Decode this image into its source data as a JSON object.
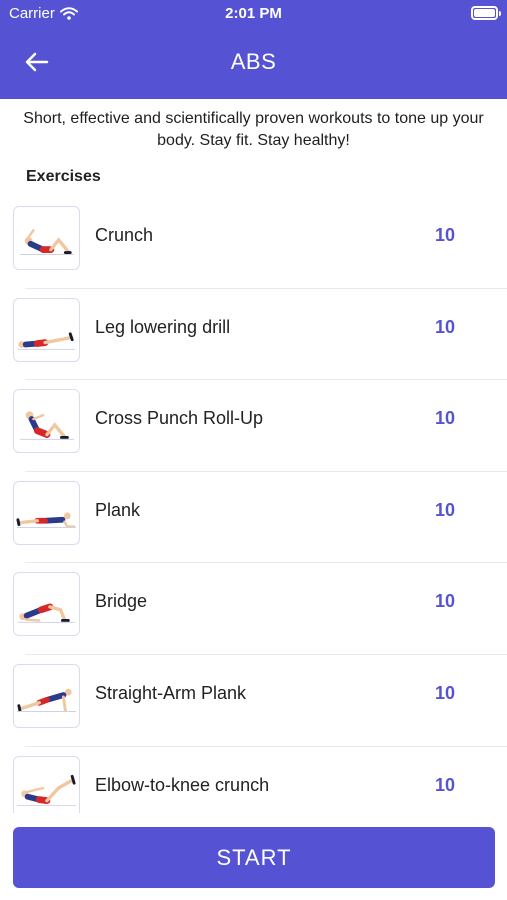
{
  "status_bar": {
    "carrier": "Carrier",
    "time": "2:01 PM"
  },
  "header": {
    "title": "ABS",
    "background": "#5553d3"
  },
  "description": "Short, effective and scientifically proven workouts to tone up your body. Stay fit. Stay healthy!",
  "section_title": "Exercises",
  "exercises": [
    {
      "name": "Crunch",
      "reps": "10"
    },
    {
      "name": "Leg lowering drill",
      "reps": "10"
    },
    {
      "name": "Cross Punch Roll-Up",
      "reps": "10"
    },
    {
      "name": "Plank",
      "reps": "10"
    },
    {
      "name": "Bridge",
      "reps": "10"
    },
    {
      "name": "Straight-Arm Plank",
      "reps": "10"
    },
    {
      "name": "Elbow-to-knee crunch",
      "reps": "10"
    }
  ],
  "start_button": {
    "label": "START"
  },
  "colors": {
    "accent": "#5553d3",
    "shorts": "#d62828",
    "shirt": "#2b3a8c"
  }
}
